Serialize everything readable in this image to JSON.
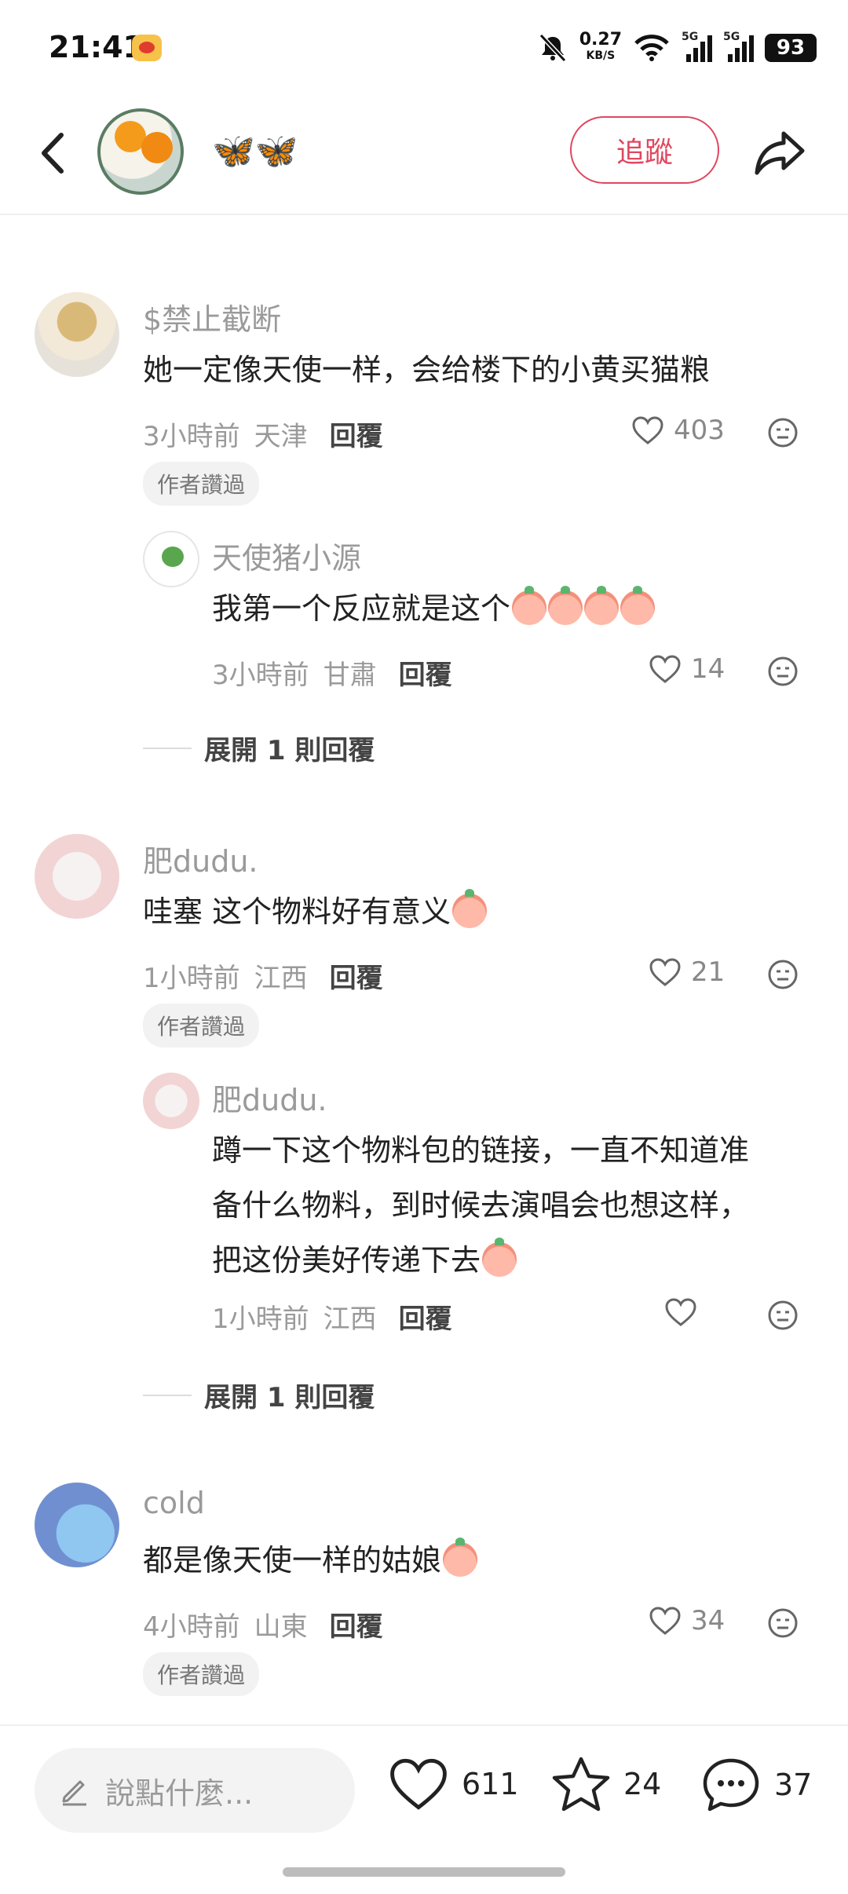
{
  "status_bar": {
    "time": "21:41",
    "net_speed": "0.27",
    "net_unit": "KB/S",
    "sig1_label": "5G",
    "sig2_label": "5G",
    "battery": "93"
  },
  "header": {
    "name": "🦋🦋",
    "follow_label": "追蹤"
  },
  "comments": [
    {
      "user": "$禁止截断",
      "text": "她一定像天使一样，会给楼下的小黄买猫粮",
      "time": "3小時前",
      "location": "天津",
      "reply_label": "回覆",
      "likes": "403",
      "badge": "作者讚過",
      "reply": {
        "user": "天使猪小源",
        "text": "我第一个反应就是这个",
        "time": "3小時前",
        "location": "甘肅",
        "reply_label": "回覆",
        "likes": "14"
      },
      "expand": "展開 1 則回覆"
    },
    {
      "user": "肥dudu.",
      "text": "哇塞 这个物料好有意义",
      "time": "1小時前",
      "location": "江西",
      "reply_label": "回覆",
      "likes": "21",
      "badge": "作者讚過",
      "reply": {
        "user": "肥dudu.",
        "text_line1": "蹲一下这个物料包的链接，一直不知道准",
        "text_line2": "备什么物料，到时候去演唱会也想这样，",
        "text_line3": "把这份美好传递下去",
        "time": "1小時前",
        "location": "江西",
        "reply_label": "回覆"
      },
      "expand": "展開 1 則回覆"
    },
    {
      "user": "cold",
      "text": "都是像天使一样的姑娘",
      "time": "4小時前",
      "location": "山東",
      "reply_label": "回覆",
      "likes": "34",
      "badge": "作者讚過"
    }
  ],
  "bottom_bar": {
    "input_placeholder": "說點什麼...",
    "likes": "611",
    "stars": "24",
    "comments": "37"
  },
  "colors": {
    "accent": "#e0475f",
    "muted": "#9a9a9a"
  }
}
